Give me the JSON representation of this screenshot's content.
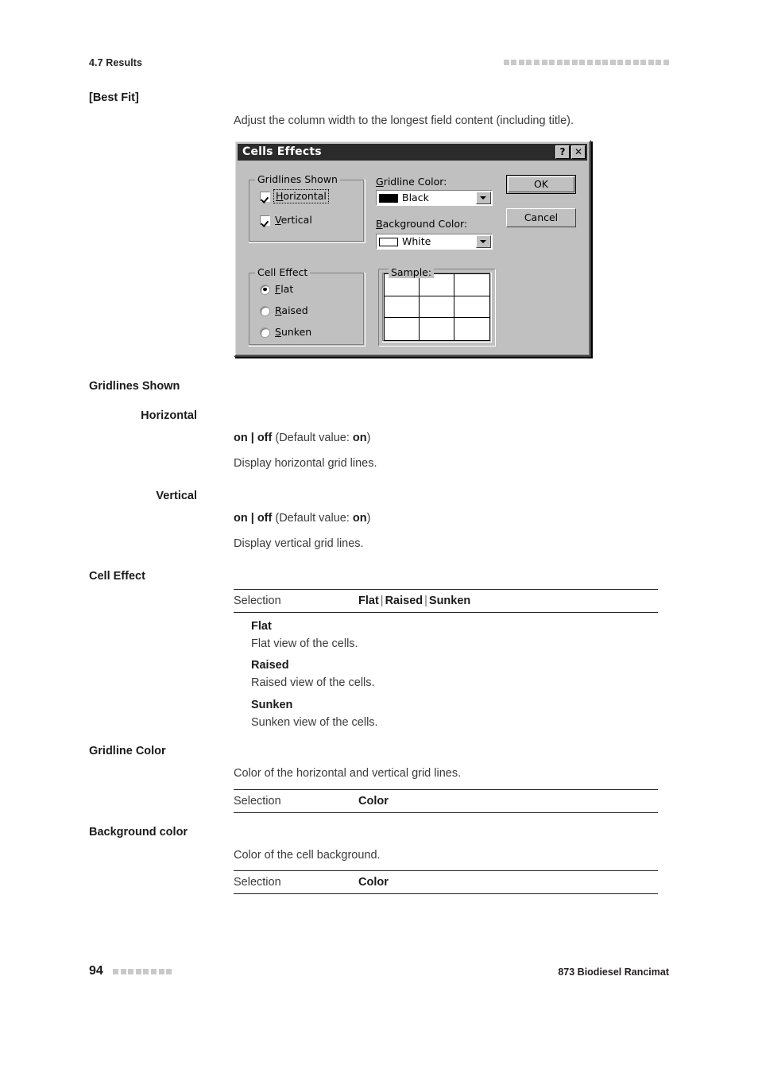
{
  "header": {
    "section": "4.7 Results",
    "decor_squares": 22
  },
  "sections": [
    {
      "heading": "[Best Fit]",
      "body": "Adjust the column width to the longest field content (including title)."
    }
  ],
  "dialog": {
    "title": "Cells Effects",
    "titlebar_buttons": [
      {
        "name": "help",
        "glyph": "?"
      },
      {
        "name": "close",
        "glyph": "✕"
      }
    ],
    "gridlines_group": {
      "title": "Gridlines Shown",
      "items": [
        {
          "label": "Horizontal",
          "accel": "H",
          "checked": true,
          "focused": true
        },
        {
          "label": "Vertical",
          "accel": "V",
          "checked": true,
          "focused": false
        }
      ]
    },
    "cell_effect_group": {
      "title": "Cell Effect",
      "items": [
        {
          "label": "Flat",
          "accel": "F",
          "selected": true
        },
        {
          "label": "Raised",
          "accel": "R",
          "selected": false
        },
        {
          "label": "Sunken",
          "accel": "S",
          "selected": false
        }
      ]
    },
    "gridline_color": {
      "label": "Gridline Color:",
      "accel": "G",
      "value": "Black",
      "swatch": "#000000"
    },
    "background_color": {
      "label": "Background Color:",
      "accel": "B",
      "value": "White",
      "swatch": "#ffffff"
    },
    "sample": {
      "title": "Sample:",
      "rows": 3,
      "cols": 3
    },
    "buttons": {
      "ok": "OK",
      "cancel": "Cancel"
    }
  },
  "content": {
    "gridlines_shown": {
      "heading": "Gridlines Shown",
      "horizontal": {
        "heading": "Horizontal",
        "values": "on | off",
        "default_text": "(Default value: ",
        "default_value": "on",
        "default_close": ")",
        "description": "Display horizontal grid lines."
      },
      "vertical": {
        "heading": "Vertical",
        "values": "on | off",
        "default_text": "(Default value: ",
        "default_value": "on",
        "default_close": ")",
        "description": "Display vertical grid lines."
      }
    },
    "cell_effect": {
      "heading": "Cell Effect",
      "selection_label": "Selection",
      "selection_values": [
        "Flat",
        "Raised",
        "Sunken"
      ],
      "options": [
        {
          "name": "Flat",
          "description": "Flat view of the cells."
        },
        {
          "name": "Raised",
          "description": "Raised view of the cells."
        },
        {
          "name": "Sunken",
          "description": "Sunken view of the cells."
        }
      ]
    },
    "gridline_color": {
      "heading": "Gridline Color",
      "description": "Color of the horizontal and vertical grid lines.",
      "selection_label": "Selection",
      "selection_value": "Color"
    },
    "background_color": {
      "heading": "Background color",
      "description": "Color of the cell background.",
      "selection_label": "Selection",
      "selection_value": "Color"
    }
  },
  "footer": {
    "page_number": "94",
    "decor_squares": 8,
    "manual_title": "873 Biodiesel Rancimat"
  }
}
